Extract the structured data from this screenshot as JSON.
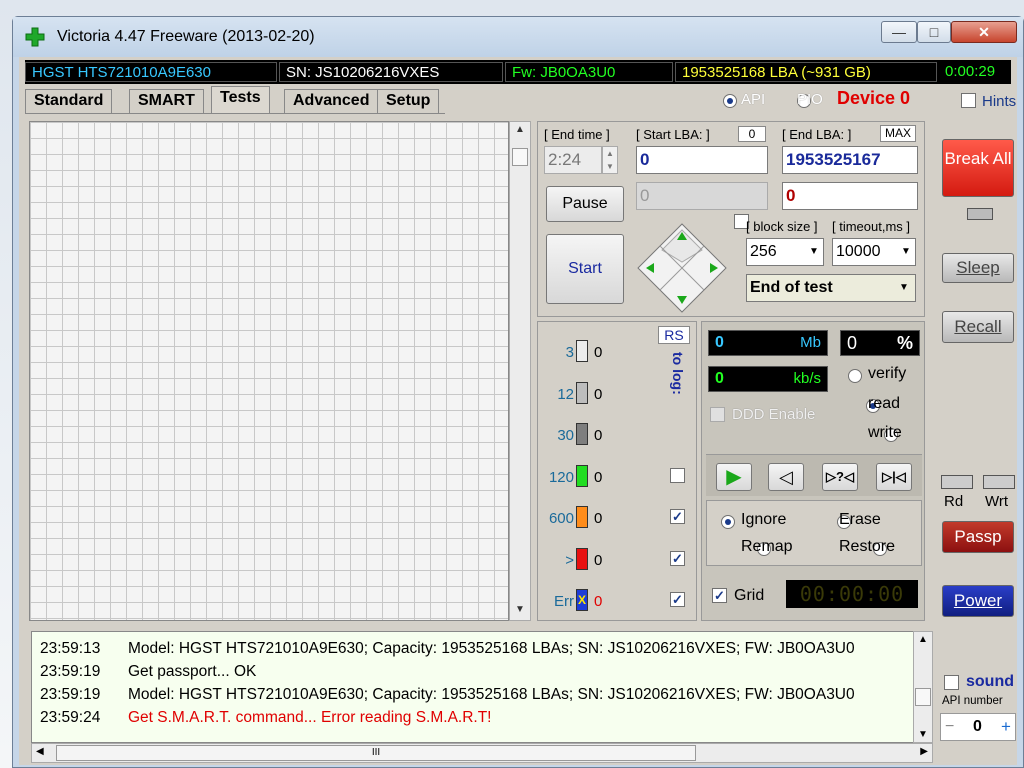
{
  "window": {
    "title": "Victoria 4.47  Freeware (2013-02-20)",
    "controls": {
      "minimize": "—",
      "maximize": "□",
      "close": "✕"
    }
  },
  "infobar": {
    "model": "HGST HTS721010A9E630",
    "sn": "SN: JS10206216VXES",
    "fw": "Fw: JB0OA3U0",
    "lba": "1953525168 LBA (~931 GB)",
    "timer": "0:00:29"
  },
  "tabs": [
    "Standard",
    "SMART",
    "Tests",
    "Advanced",
    "Setup"
  ],
  "interface": {
    "api": "API",
    "pio": "PIO",
    "device": "Device 0",
    "hints": "Hints"
  },
  "test": {
    "end_time_label": "[ End time ]",
    "end_time": "2:24",
    "start_lba_label": "[ Start LBA: ]",
    "start_lba_counter": "0",
    "start_lba": "0",
    "start_lba_current": "0",
    "end_lba_label": "[ End LBA: ]",
    "max_label": "MAX",
    "end_lba": "1953525167",
    "end_lba_current": "0",
    "pause": "Pause",
    "start": "Start",
    "block_size_label": "[ block size ]",
    "block_size": "256",
    "timeout_label": "[ timeout,ms ]",
    "timeout": "10000",
    "end_action": "End of test"
  },
  "counts": {
    "rs": "RS",
    "to_log": "to log:",
    "rows": [
      {
        "label": "3",
        "count": "0",
        "color": "#ececec",
        "logged": false
      },
      {
        "label": "12",
        "count": "0",
        "color": "#bdbdbd",
        "logged": false
      },
      {
        "label": "30",
        "count": "0",
        "color": "#7e7e7e",
        "logged": false
      },
      {
        "label": "120",
        "count": "0",
        "color": "#22dd22",
        "logged": false
      },
      {
        "label": "600",
        "count": "0",
        "color": "#ff8c1a",
        "logged": true
      },
      {
        "label": ">",
        "count": "0",
        "color": "#e81010",
        "logged": true
      },
      {
        "label": "Err",
        "count": "0",
        "color": "#1e3cd8",
        "logged": true
      }
    ]
  },
  "stats": {
    "mb_value": "0",
    "mb_unit": "Mb",
    "pct_value": "0",
    "pct_unit": "%",
    "kbs_value": "0",
    "kbs_unit": "kb/s",
    "ddd": "DDD Enable",
    "modes": [
      "verify",
      "read",
      "write"
    ],
    "mode_selected": "read",
    "player": {
      "play": "▶",
      "back": "◁",
      "skip": "▷?◁",
      "end": "▷|◁"
    },
    "actions": [
      "Ignore",
      "Erase",
      "Remap",
      "Restore"
    ],
    "action_selected": "Ignore",
    "grid_label": "Grid",
    "grid_timer": "00:00:00"
  },
  "side": {
    "break_all": "Break All",
    "sleep": "Sleep",
    "recall": "Recall",
    "rd": "Rd",
    "wrt": "Wrt",
    "passp": "Passp",
    "power": "Power",
    "sound": "sound",
    "api_number_label": "API number",
    "api_number": "0",
    "minus": "−",
    "plus": "+"
  },
  "log": [
    {
      "time": "23:59:13",
      "text": "Model: HGST HTS721010A9E630; Capacity: 1953525168 LBAs; SN: JS10206216VXES; FW: JB0OA3U0",
      "error": false
    },
    {
      "time": "23:59:19",
      "text": "Get passport... OK",
      "error": false
    },
    {
      "time": "23:59:19",
      "text": "Model: HGST HTS721010A9E630; Capacity: 1953525168 LBAs; SN: JS10206216VXES; FW: JB0OA3U0",
      "error": false
    },
    {
      "time": "23:59:24",
      "text": "Get S.M.A.R.T. command... Error reading S.M.A.R.T!",
      "error": true
    }
  ],
  "scroll": {
    "up": "▲",
    "down": "▼",
    "left": "◀",
    "right": "▶",
    "thumb": "III"
  }
}
